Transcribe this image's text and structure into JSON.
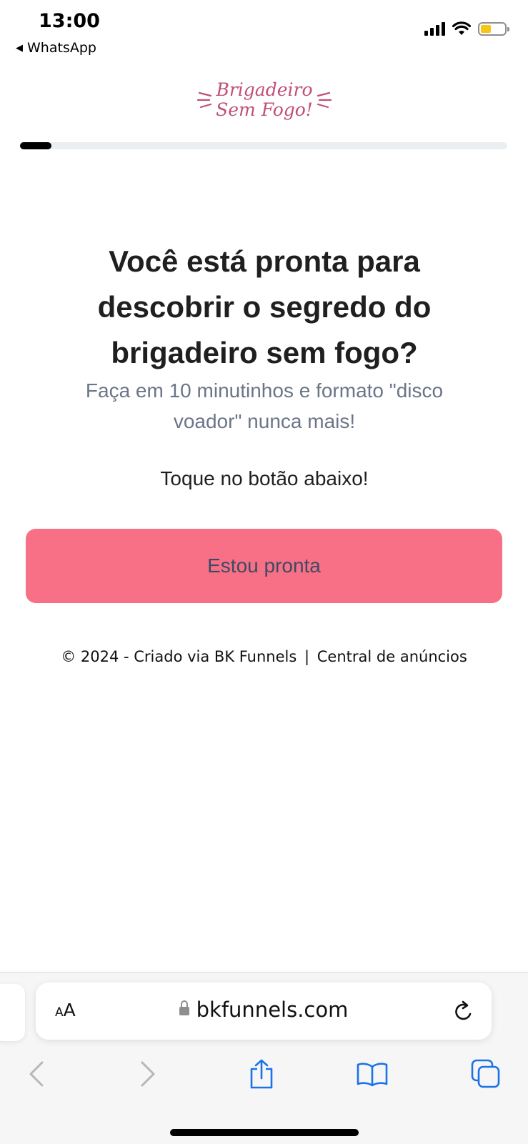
{
  "status_bar": {
    "time": "13:00",
    "back_app": "WhatsApp",
    "battery_color": "#f5c518"
  },
  "logo": {
    "line1": "Brigadeiro",
    "line2": "Sem Fogo!",
    "color": "#c04f79"
  },
  "progress": {
    "fraction": 0.065
  },
  "main": {
    "headline": "Você está pronta para descobrir o segredo do brigadeiro sem fogo?",
    "subtitle": "Faça em 10 minutinhos e formato \"disco voador\" nunca mais!",
    "instruction": "Toque no botão abaixo!",
    "cta_label": "Estou pronta",
    "cta_color": "#f77085"
  },
  "footer": {
    "copyright": "© 2024 - Criado via BK Funnels",
    "separator": "|",
    "link": "Central de anúncios"
  },
  "browser": {
    "text_size_label_small": "A",
    "text_size_label_large": "A",
    "url": "bkfunnels.com",
    "accent": "#1a73e8",
    "icons": [
      "back-icon",
      "forward-icon",
      "share-icon",
      "bookmarks-icon",
      "tabs-icon",
      "reload-icon",
      "lock-icon"
    ]
  }
}
